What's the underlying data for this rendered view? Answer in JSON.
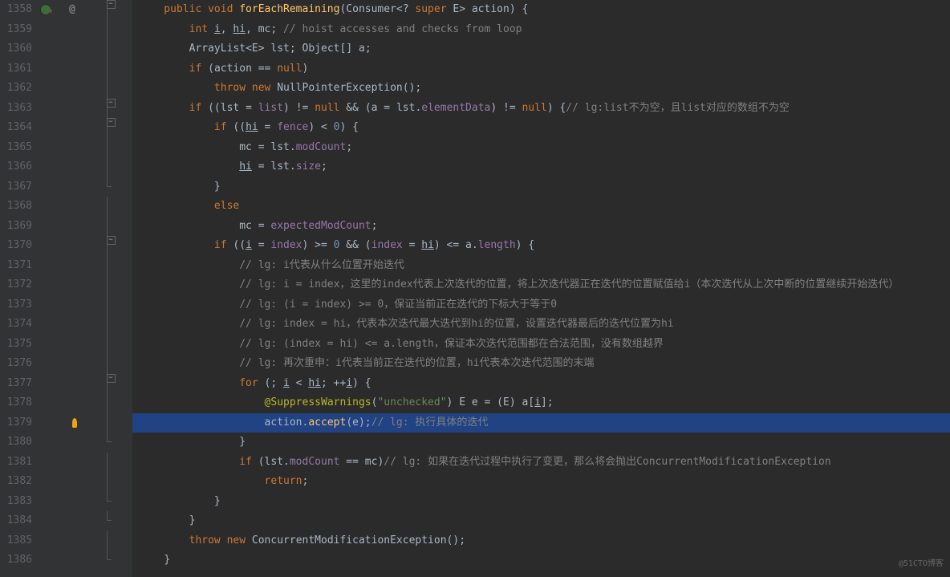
{
  "startLine": 1358,
  "highlightedLine": 1379,
  "bulbLine": 1379,
  "vcsLine": 1358,
  "atLine": 1358,
  "watermark": "@51CTO博客",
  "code": [
    [
      [
        "kw",
        "    public "
      ],
      [
        "kw",
        "void "
      ],
      [
        "fn",
        "forEachRemaining"
      ],
      [
        "paren",
        "("
      ],
      [
        "type",
        "Consumer"
      ],
      [
        "op",
        "<? "
      ],
      [
        "kw",
        "super "
      ],
      [
        "type",
        "E"
      ],
      [
        "op",
        "> "
      ],
      [
        "local",
        "action"
      ],
      [
        "paren",
        ") {"
      ]
    ],
    [
      [
        "pl",
        "        "
      ],
      [
        "kw",
        "int "
      ],
      [
        "local under",
        "i"
      ],
      [
        "op",
        ", "
      ],
      [
        "local under",
        "hi"
      ],
      [
        "op",
        ", "
      ],
      [
        "local",
        "mc"
      ],
      [
        "op",
        "; "
      ],
      [
        "cmt",
        "// hoist accesses and checks from loop"
      ]
    ],
    [
      [
        "pl",
        "        "
      ],
      [
        "type",
        "ArrayList"
      ],
      [
        "op",
        "<"
      ],
      [
        "type",
        "E"
      ],
      [
        "op",
        "> "
      ],
      [
        "local",
        "lst"
      ],
      [
        "op",
        "; "
      ],
      [
        "type",
        "Object"
      ],
      [
        "op",
        "[] "
      ],
      [
        "local",
        "a"
      ],
      [
        "op",
        ";"
      ]
    ],
    [
      [
        "pl",
        "        "
      ],
      [
        "kw",
        "if "
      ],
      [
        "paren",
        "("
      ],
      [
        "local",
        "action"
      ],
      [
        "op",
        " == "
      ],
      [
        "kw",
        "null"
      ],
      [
        "paren",
        ")"
      ]
    ],
    [
      [
        "pl",
        "            "
      ],
      [
        "kw",
        "throw new "
      ],
      [
        "type",
        "NullPointerException"
      ],
      [
        "paren",
        "();"
      ]
    ],
    [
      [
        "pl",
        "        "
      ],
      [
        "kw",
        "if "
      ],
      [
        "paren",
        "(("
      ],
      [
        "local",
        "lst"
      ],
      [
        "op",
        " = "
      ],
      [
        "field",
        "list"
      ],
      [
        "paren",
        ")"
      ],
      [
        "op",
        " != "
      ],
      [
        "kw",
        "null"
      ],
      [
        "op",
        " && "
      ],
      [
        "paren",
        "("
      ],
      [
        "local",
        "a"
      ],
      [
        "op",
        " = "
      ],
      [
        "local",
        "lst"
      ],
      [
        "op",
        "."
      ],
      [
        "field",
        "elementData"
      ],
      [
        "paren",
        ")"
      ],
      [
        "op",
        " != "
      ],
      [
        "kw",
        "null"
      ],
      [
        "paren",
        ") {"
      ],
      [
        "cmt",
        "// lg:list不为空，且list对应的数组不为空"
      ]
    ],
    [
      [
        "pl",
        "            "
      ],
      [
        "kw",
        "if "
      ],
      [
        "paren",
        "(("
      ],
      [
        "local under",
        "hi"
      ],
      [
        "op",
        " = "
      ],
      [
        "field",
        "fence"
      ],
      [
        "paren",
        ")"
      ],
      [
        "op",
        " < "
      ],
      [
        "num",
        "0"
      ],
      [
        "paren",
        ") {"
      ]
    ],
    [
      [
        "pl",
        "                "
      ],
      [
        "local",
        "mc"
      ],
      [
        "op",
        " = "
      ],
      [
        "local",
        "lst"
      ],
      [
        "op",
        "."
      ],
      [
        "field",
        "modCount"
      ],
      [
        "op",
        ";"
      ]
    ],
    [
      [
        "pl",
        "                "
      ],
      [
        "local under",
        "hi"
      ],
      [
        "op",
        " = "
      ],
      [
        "local",
        "lst"
      ],
      [
        "op",
        "."
      ],
      [
        "field",
        "size"
      ],
      [
        "op",
        ";"
      ]
    ],
    [
      [
        "pl",
        "            "
      ],
      [
        "paren",
        "}"
      ]
    ],
    [
      [
        "pl",
        "            "
      ],
      [
        "kw",
        "else"
      ]
    ],
    [
      [
        "pl",
        "                "
      ],
      [
        "local",
        "mc"
      ],
      [
        "op",
        " = "
      ],
      [
        "field",
        "expectedModCount"
      ],
      [
        "op",
        ";"
      ]
    ],
    [
      [
        "pl",
        "            "
      ],
      [
        "kw",
        "if "
      ],
      [
        "paren",
        "(("
      ],
      [
        "local under",
        "i"
      ],
      [
        "op",
        " = "
      ],
      [
        "field",
        "index"
      ],
      [
        "paren",
        ")"
      ],
      [
        "op",
        " >= "
      ],
      [
        "num",
        "0"
      ],
      [
        "op",
        " && "
      ],
      [
        "paren",
        "("
      ],
      [
        "field",
        "index"
      ],
      [
        "op",
        " = "
      ],
      [
        "local under",
        "hi"
      ],
      [
        "paren",
        ")"
      ],
      [
        "op",
        " <= "
      ],
      [
        "local",
        "a"
      ],
      [
        "op",
        "."
      ],
      [
        "field",
        "length"
      ],
      [
        "paren",
        ") {"
      ]
    ],
    [
      [
        "pl",
        "                "
      ],
      [
        "cmt",
        "// lg: i代表从什么位置开始迭代"
      ]
    ],
    [
      [
        "pl",
        "                "
      ],
      [
        "cmt",
        "// lg: i = index，这里的index代表上次迭代的位置，将上次迭代器正在迭代的位置赋值给i（本次迭代从上次中断的位置继续开始迭代）"
      ]
    ],
    [
      [
        "pl",
        "                "
      ],
      [
        "cmt",
        "// lg: (i = index) >= 0，保证当前正在迭代的下标大于等于0"
      ]
    ],
    [
      [
        "pl",
        "                "
      ],
      [
        "cmt",
        "// lg: index = hi，代表本次迭代最大迭代到hi的位置，设置迭代器最后的迭代位置为hi"
      ]
    ],
    [
      [
        "pl",
        "                "
      ],
      [
        "cmt",
        "// lg: (index = hi) <= a.length，保证本次迭代范围都在合法范围，没有数组越界"
      ]
    ],
    [
      [
        "pl",
        "                "
      ],
      [
        "cmt",
        "// lg: 再次重申：i代表当前正在迭代的位置，hi代表本次迭代范围的末端"
      ]
    ],
    [
      [
        "pl",
        "                "
      ],
      [
        "kw",
        "for "
      ],
      [
        "paren",
        "(; "
      ],
      [
        "local under",
        "i"
      ],
      [
        "op",
        " < "
      ],
      [
        "local under",
        "hi"
      ],
      [
        "op",
        "; ++"
      ],
      [
        "local under",
        "i"
      ],
      [
        "paren",
        ") {"
      ]
    ],
    [
      [
        "pl",
        "                    "
      ],
      [
        "anno",
        "@SuppressWarnings"
      ],
      [
        "paren",
        "("
      ],
      [
        "str",
        "\"unchecked\""
      ],
      [
        "paren",
        ") "
      ],
      [
        "type",
        "E "
      ],
      [
        "local",
        "e"
      ],
      [
        "op",
        " = "
      ],
      [
        "paren",
        "("
      ],
      [
        "type",
        "E"
      ],
      [
        "paren",
        ") "
      ],
      [
        "local",
        "a"
      ],
      [
        "op",
        "["
      ],
      [
        "local under",
        "i"
      ],
      [
        "op",
        "];"
      ]
    ],
    [
      [
        "pl",
        "                    "
      ],
      [
        "local",
        "action"
      ],
      [
        "op",
        "."
      ],
      [
        "fn",
        "accept"
      ],
      [
        "paren",
        "("
      ],
      [
        "local",
        "e"
      ],
      [
        "paren",
        ");"
      ],
      [
        "cmt",
        "// lg: 执行具体的迭代"
      ]
    ],
    [
      [
        "pl",
        "                "
      ],
      [
        "paren",
        "}"
      ]
    ],
    [
      [
        "pl",
        "                "
      ],
      [
        "kw",
        "if "
      ],
      [
        "paren",
        "("
      ],
      [
        "local",
        "lst"
      ],
      [
        "op",
        "."
      ],
      [
        "field",
        "modCount"
      ],
      [
        "op",
        " == "
      ],
      [
        "local",
        "mc"
      ],
      [
        "paren",
        ")"
      ],
      [
        "cmt",
        "// lg: 如果在迭代过程中执行了变更，那么将会抛出ConcurrentModificationException"
      ]
    ],
    [
      [
        "pl",
        "                    "
      ],
      [
        "kw",
        "return"
      ],
      [
        "op",
        ";"
      ]
    ],
    [
      [
        "pl",
        "            "
      ],
      [
        "paren",
        "}"
      ]
    ],
    [
      [
        "pl",
        "        "
      ],
      [
        "paren",
        "}"
      ]
    ],
    [
      [
        "pl",
        "        "
      ],
      [
        "kw",
        "throw new "
      ],
      [
        "type",
        "ConcurrentModificationException"
      ],
      [
        "paren",
        "();"
      ]
    ],
    [
      [
        "pl",
        "    "
      ],
      [
        "paren",
        "}"
      ]
    ]
  ],
  "foldMarks": {
    "1358": "open",
    "1363": "child",
    "1364": "child",
    "1367": "close",
    "1370": "child",
    "1377": "child",
    "1380": "close",
    "1383": "close",
    "1384": "close",
    "1386": "close"
  }
}
